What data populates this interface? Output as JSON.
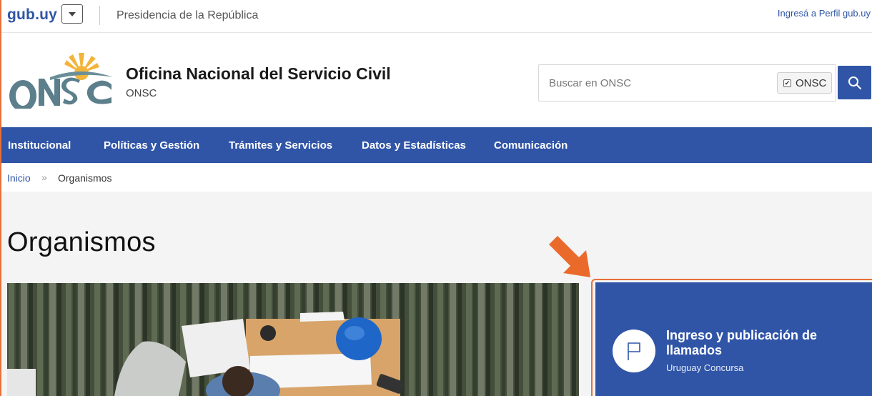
{
  "topbar": {
    "logo": "gub.uy",
    "presidencia": "Presidencia de la República",
    "perfil_link": "Ingresá a Perfil gub.uy"
  },
  "header": {
    "logo_alt": "ONSC",
    "title": "Oficina Nacional del Servicio Civil",
    "subtitle": "ONSC",
    "search": {
      "placeholder": "Buscar en ONSC",
      "scope_label": "ONSC",
      "scope_checked": true,
      "button_icon": "search-icon"
    }
  },
  "nav": {
    "items": [
      {
        "label": "Institucional"
      },
      {
        "label": "Políticas y Gestión"
      },
      {
        "label": "Trámites y Servicios"
      },
      {
        "label": "Datos y Estadísticas"
      },
      {
        "label": "Comunicación"
      }
    ]
  },
  "breadcrumb": {
    "home": "Inicio",
    "separator": "»",
    "current": "Organismos"
  },
  "main": {
    "page_title": "Organismos",
    "card": {
      "title": "Ingreso y publicación de llamados",
      "subtitle": "Uruguay Concursa",
      "icon": "flag-icon"
    }
  },
  "colors": {
    "brand_blue": "#3055a7",
    "highlight_orange": "#e8703a"
  }
}
